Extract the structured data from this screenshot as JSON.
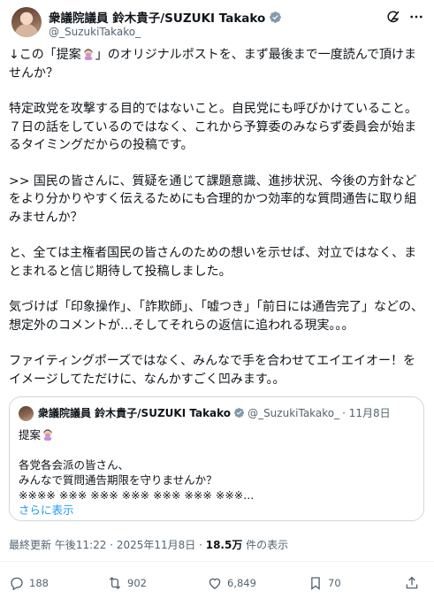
{
  "author": {
    "display_name": "衆議院議員 鈴木貴子/SUZUKI Takako",
    "handle": "@_SuzukiTakako_"
  },
  "post": {
    "p1_a": "↓この「提案",
    "p1_b": "」のオリジナルポストを、まず最後まで一度読んで頂けませんか？",
    "p2": "特定政党を攻撃する目的ではないこと。自民党にも呼びかけていること。７日の話をしているのではなく、これから予算委のみならず委員会が始まるタイミングだからの投稿です。",
    "p3": ">> 国民の皆さんに、質疑を通じて課題意識、進捗状況、今後の方針などをより分かりやすく伝えるためにも合理的かつ効率的な質問通告に取り組みませんか？",
    "p4": "と、全ては主権者国民の皆さんのための想いを示せば、対立ではなく、まとまれると信じ期待して投稿しました。",
    "p5": "気づけば「印象操作」、「詐欺師」、「嘘つき」「前日には通告完了」などの、想定外のコメントが…そしてそれらの返信に追われる現実。。。",
    "p6": "ファイティングポーズではなく、みんなで手を合わせてエイエイオー！をイメージしてただけに、なんかすごく凹みます。。"
  },
  "quote": {
    "display_name": "衆議院議員 鈴木貴子/SUZUKI Takako",
    "handle": "@_SuzukiTakako_",
    "date": "· 11月8日",
    "line1": "提案",
    "line2": "各党各会派の皆さん、",
    "line3": "みんなで質問通告期限を守りませんか？",
    "line4": "※※※※ ※※※ ※※※ ※※※ ※※※ ※※※ ※※※...",
    "show_more": "さらに表示"
  },
  "meta": {
    "updated": "最終更新 午後11:22 · 2025年11月8日 · ",
    "views": "18.5万",
    "views_suffix": " 件の表示"
  },
  "actions": {
    "replies": "188",
    "reposts": "902",
    "likes": "6,849",
    "bookmarks": "70"
  },
  "icons": [
    "verified-icon",
    "grok-icon",
    "more-icon",
    "facepalm-emoji",
    "reply-icon",
    "repost-icon",
    "like-icon",
    "bookmark-icon",
    "share-icon"
  ],
  "colors": {
    "accent": "#1d9bf0",
    "verified": "#829aab",
    "muted": "#536471"
  }
}
